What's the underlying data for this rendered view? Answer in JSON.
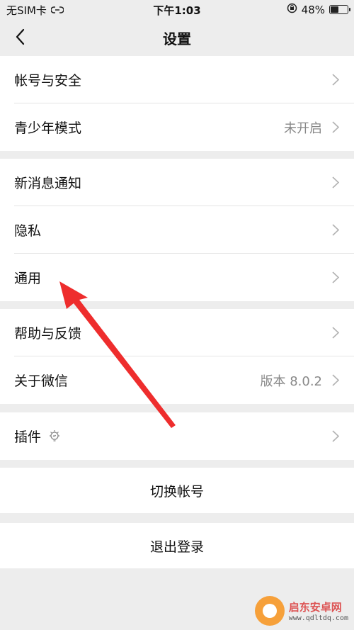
{
  "status": {
    "carrier": "无SIM卡",
    "time": "下午1:03",
    "battery_text": "48%",
    "battery_level": 0.48
  },
  "nav": {
    "title": "设置"
  },
  "groups": [
    {
      "items": [
        {
          "label": "帐号与安全",
          "value": ""
        },
        {
          "label": "青少年模式",
          "value": "未开启"
        }
      ]
    },
    {
      "items": [
        {
          "label": "新消息通知",
          "value": ""
        },
        {
          "label": "隐私",
          "value": ""
        },
        {
          "label": "通用",
          "value": ""
        }
      ]
    },
    {
      "items": [
        {
          "label": "帮助与反馈",
          "value": ""
        },
        {
          "label": "关于微信",
          "value": "版本 8.0.2"
        }
      ]
    },
    {
      "items": [
        {
          "label": "插件",
          "value": ""
        }
      ]
    }
  ],
  "actions": {
    "switch_account": "切换帐号",
    "logout": "退出登录"
  },
  "watermark": {
    "name": "启东安卓网",
    "url": "www.qdltdq.com"
  },
  "colors": {
    "annotation_arrow": "#ee2d2d",
    "background": "#ededed"
  },
  "icons": {
    "back": "chevron-left-icon",
    "row_chevron": "chevron-right-icon",
    "plugin": "bulb-icon",
    "link": "link-icon",
    "lock": "rotation-lock-icon"
  }
}
